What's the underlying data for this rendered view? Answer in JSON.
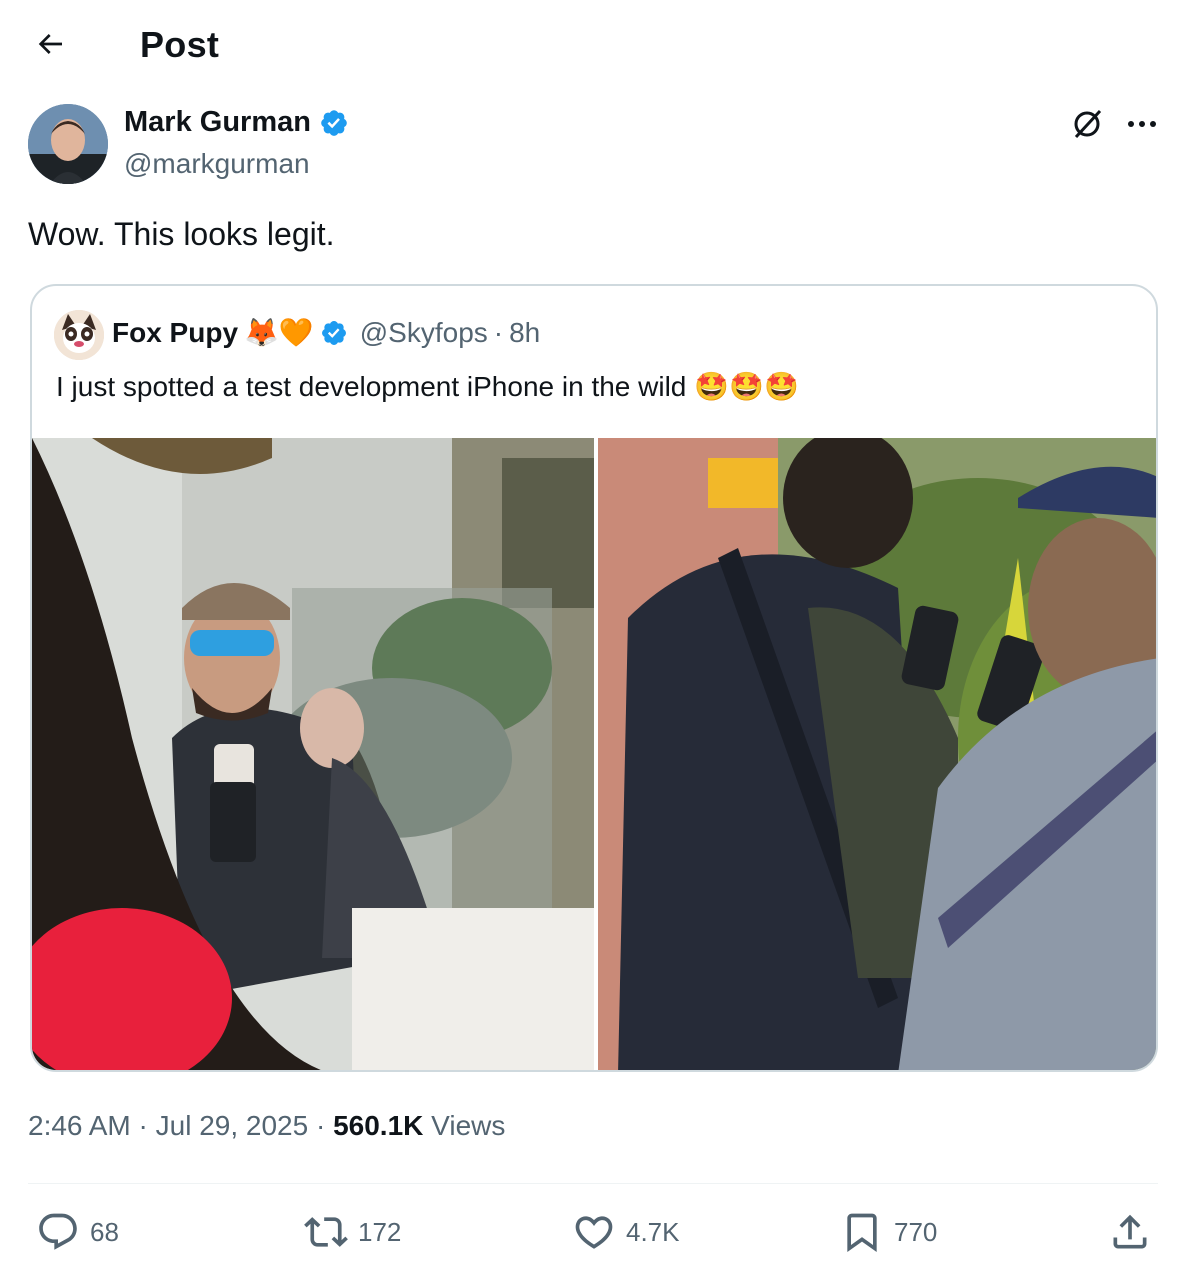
{
  "header": {
    "title": "Post",
    "back_icon": "arrow-left-icon"
  },
  "author": {
    "name": "Mark Gurman",
    "handle": "@markgurman",
    "verified": true
  },
  "tweet": {
    "text": "Wow. This looks legit."
  },
  "quoted": {
    "name": "Fox Pupy",
    "name_emojis": "🦊🧡",
    "handle": "@Skyfops",
    "time": "8h",
    "text": "I just spotted a test development iPhone in the wild",
    "text_emojis": "🤩🤩🤩",
    "photos": [
      "photo-1",
      "photo-2"
    ]
  },
  "meta": {
    "time": "2:46 AM",
    "date": "Jul 29, 2025",
    "views_count": "560.1K",
    "views_label": "Views"
  },
  "actions": {
    "replies": "68",
    "reposts": "172",
    "likes": "4.7K",
    "bookmarks": "770"
  },
  "colors": {
    "verified": "#1d9bf0",
    "secondary_text": "#536471",
    "border": "#cfd9de"
  }
}
